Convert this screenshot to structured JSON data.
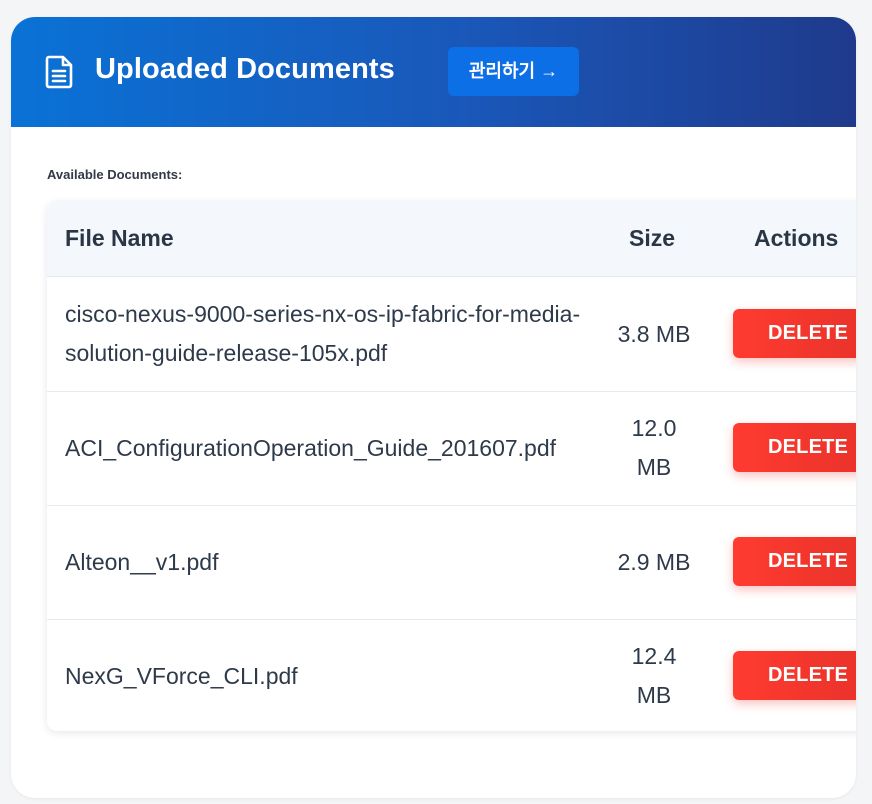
{
  "header": {
    "icon": "document-icon",
    "title": "Uploaded Documents",
    "manage_label": "관리하기 →"
  },
  "section": {
    "label": "Available Documents:"
  },
  "table": {
    "columns": {
      "name": "File Name",
      "size": "Size",
      "actions": "Actions"
    },
    "rows": [
      {
        "name": "cisco-nexus-9000-series-nx-os-ip-fabric-for-media-solution-guide-release-105x.pdf",
        "size": "3.8 MB",
        "action": "DELETE"
      },
      {
        "name": "ACI_ConfigurationOperation_Guide_201607.pdf",
        "size": "12.0 MB",
        "action": "DELETE"
      },
      {
        "name": "Alteon__v1.pdf",
        "size": "2.9 MB",
        "action": "DELETE"
      },
      {
        "name": "NexG_VForce_CLI.pdf",
        "size": "12.4 MB",
        "action": "DELETE"
      }
    ]
  },
  "colors": {
    "header_gradient_start": "#0a72d6",
    "header_gradient_end": "#1f3a8c",
    "manage_button": "#0d6fe6",
    "delete_button": "#ff3b30"
  }
}
